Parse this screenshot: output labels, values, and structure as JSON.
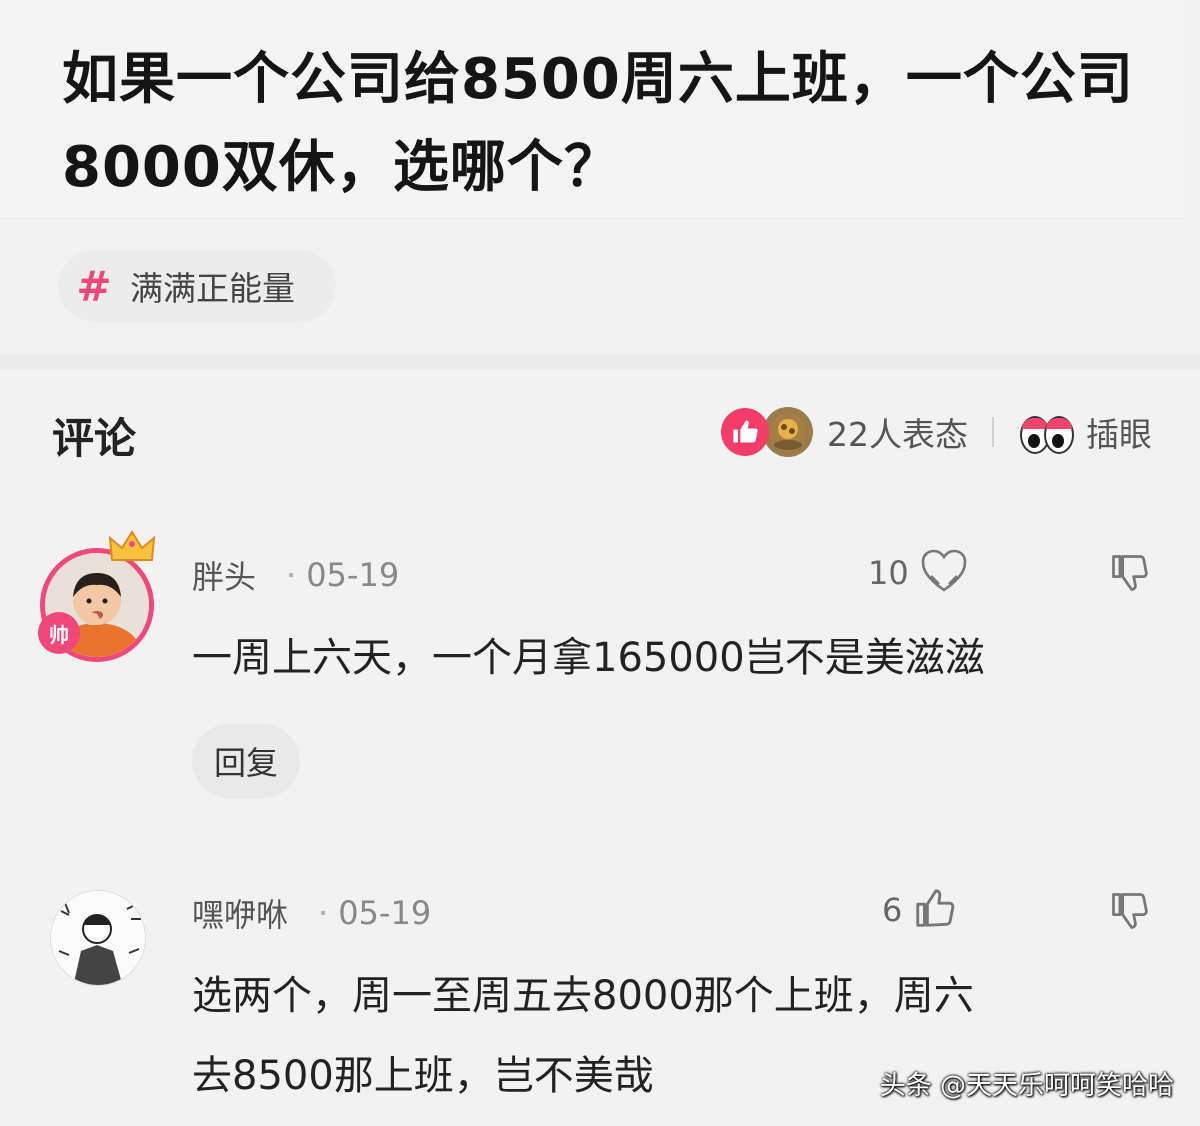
{
  "question": {
    "title": "如果一个公司给8500周六上班，一个公司8000双休，选哪个？"
  },
  "topic": {
    "hash": "#",
    "label": "满满正能量"
  },
  "comments_header": {
    "title": "评论",
    "reaction_count": "22人表态",
    "chayan_label": "插眼"
  },
  "comments": [
    {
      "user": "胖头",
      "date": "05-19",
      "likes": "10",
      "text": "一周上六天，一个月拿165000岂不是美滋滋",
      "reply_label": "回复",
      "avatar_badge": "帅"
    },
    {
      "user": "嘿咿咻",
      "date": "05-19",
      "likes": "6",
      "text_lines": [
        "选两个，周一至周五去8000那个上班，周六",
        "去8500那上班，岂不美哉"
      ]
    }
  ],
  "watermark": "头条 @天天乐呵呵笑哈哈",
  "colors": {
    "accent_pink": "#f0487a",
    "background": "#f2f2f2"
  }
}
